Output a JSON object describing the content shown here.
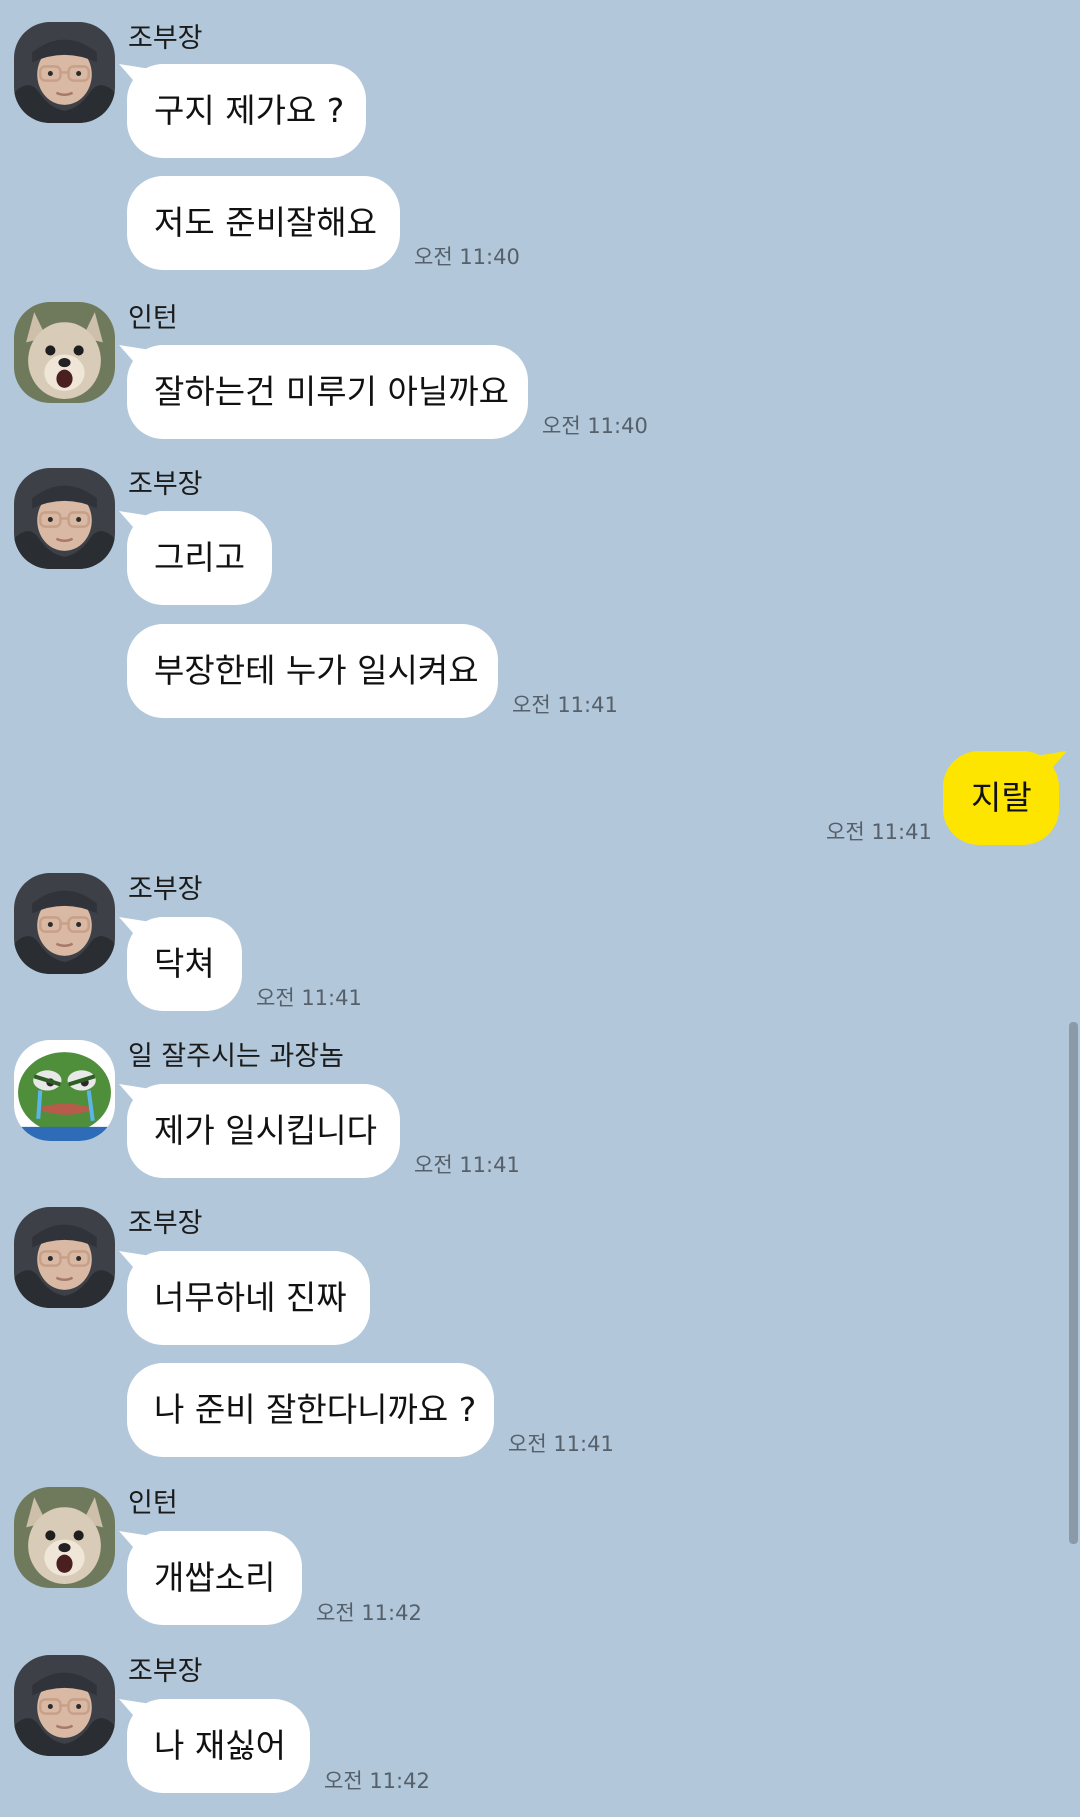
{
  "messages": {
    "m1": {
      "sender": "조부장",
      "text": "구지 제가요 ?"
    },
    "m2": {
      "text": "저도 준비잘해요",
      "time": "오전 11:40"
    },
    "m3": {
      "sender": "인턴",
      "text": "잘하는건 미루기 아닐까요",
      "time": "오전 11:40"
    },
    "m4": {
      "sender": "조부장",
      "text": "그리고"
    },
    "m5": {
      "text": "부장한테 누가 일시켜요",
      "time": "오전 11:41"
    },
    "m6": {
      "text": "지랄",
      "time": "오전 11:41"
    },
    "m7": {
      "sender": "조부장",
      "text": "닥쳐",
      "time": "오전 11:41"
    },
    "m8": {
      "sender": "일 잘주시는 과장놈",
      "text": "제가 일시킵니다",
      "time": "오전 11:41"
    },
    "m9": {
      "sender": "조부장",
      "text": "너무하네 진짜"
    },
    "m10": {
      "text": "나 준비 잘한다니까요 ?",
      "time": "오전 11:41"
    },
    "m11": {
      "sender": "인턴",
      "text": "개쌉소리",
      "time": "오전 11:42"
    },
    "m12": {
      "sender": "조부장",
      "text": "나 재싫어",
      "time": "오전 11:42"
    }
  },
  "colors": {
    "background": "#b2c7da",
    "incoming_bubble": "#ffffff",
    "outgoing_bubble": "#fee500"
  },
  "icons": {
    "avatar_jo": "avatar-jo-bujang-icon",
    "avatar_intern": "avatar-intern-dog-icon",
    "avatar_manager": "avatar-manager-frog-icon"
  }
}
